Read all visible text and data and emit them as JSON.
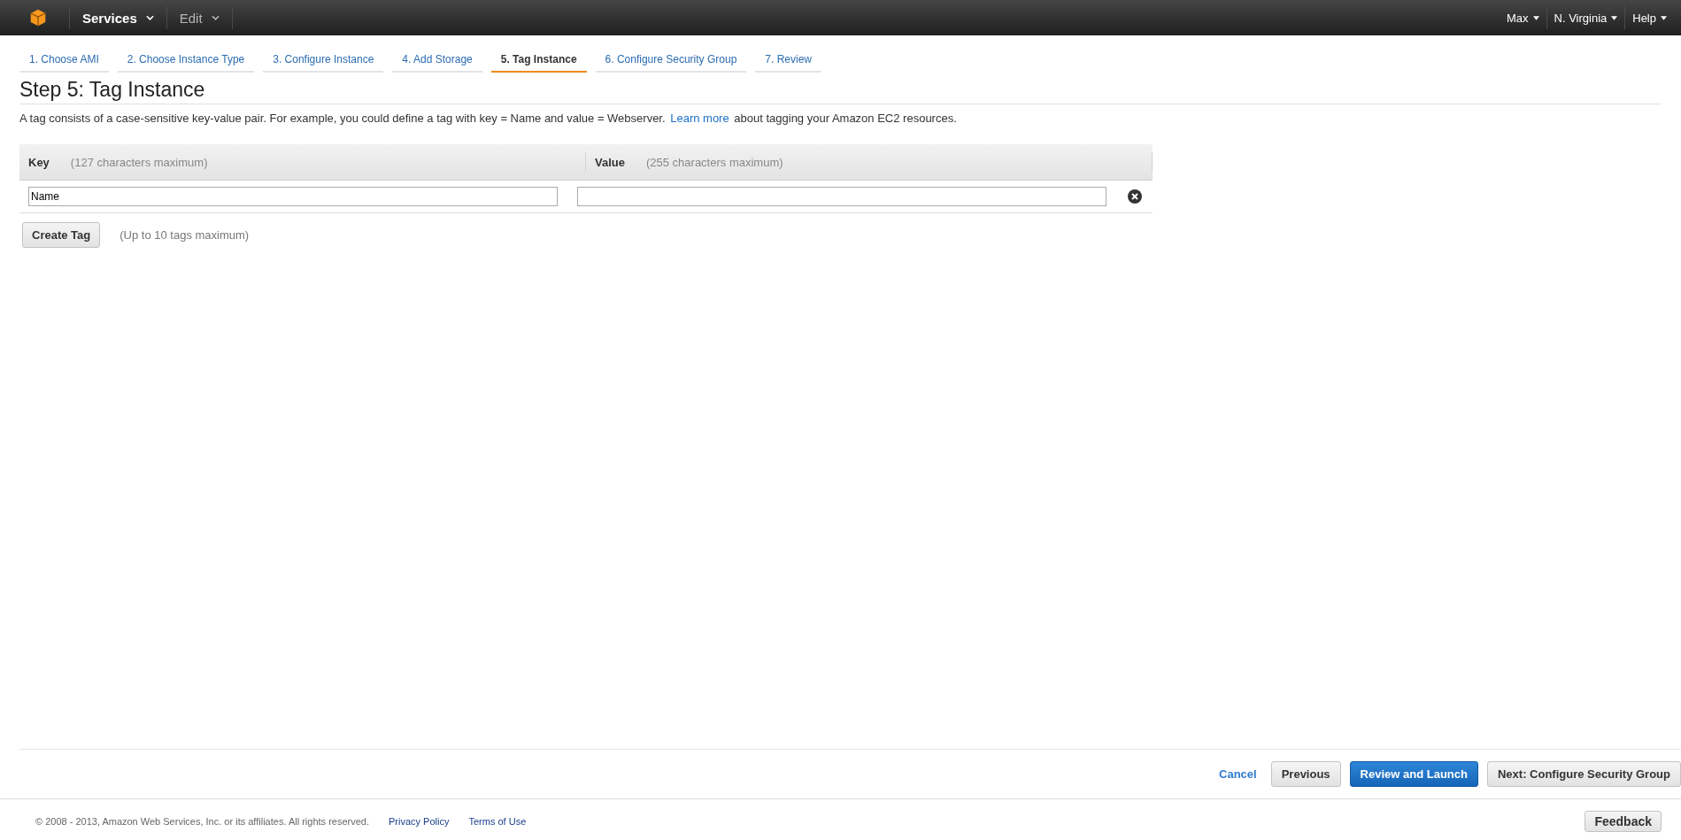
{
  "top_bar": {
    "menus": [
      {
        "label": "Services",
        "disabled": false
      },
      {
        "label": "Edit",
        "disabled": true
      }
    ],
    "right_menus": [
      {
        "label": "Max"
      },
      {
        "label": "N. Virginia"
      },
      {
        "label": "Help"
      }
    ]
  },
  "wizard_tabs": [
    {
      "label": "1. Choose AMI",
      "selected": false
    },
    {
      "label": "2. Choose Instance Type",
      "selected": false
    },
    {
      "label": "3. Configure Instance",
      "selected": false
    },
    {
      "label": "4. Add Storage",
      "selected": false
    },
    {
      "label": "5. Tag Instance",
      "selected": true
    },
    {
      "label": "6. Configure Security Group",
      "selected": false
    },
    {
      "label": "7. Review",
      "selected": false
    }
  ],
  "heading": "Step 5: Tag Instance",
  "description": {
    "before": "A tag consists of a case-sensitive key-value pair. For example, you could define a tag with key = Name and value = Webserver.",
    "link": "Learn more",
    "after": "about tagging your Amazon EC2 resources."
  },
  "table": {
    "columns": [
      {
        "label": "Key",
        "hint": "(127 characters maximum)"
      },
      {
        "label": "Value",
        "hint": "(255 characters maximum)"
      }
    ],
    "rows": [
      {
        "key": "Name"
      }
    ]
  },
  "create_tag": {
    "button": "Create Tag",
    "hint": "(Up to 10 tags maximum)"
  },
  "actions": [
    {
      "label": "Cancel",
      "kind": "link"
    },
    {
      "label": "Previous",
      "kind": "secondary"
    },
    {
      "label": "Review and Launch",
      "kind": "primary"
    },
    {
      "label": "Next: Configure Security Group",
      "kind": "secondary"
    }
  ],
  "footer": {
    "copyright": "© 2008 - 2013, Amazon Web Services, Inc. or its affiliates. All rights reserved.",
    "links": [
      "Privacy Policy",
      "Terms of Use"
    ],
    "feedback": "Feedback"
  }
}
